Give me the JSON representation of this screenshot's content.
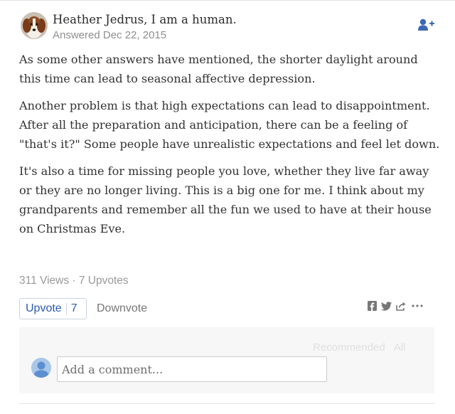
{
  "answer": {
    "author_line": "Heather Jedrus, I am a human.",
    "answered": "Answered Dec 22, 2015",
    "avatar_icon": "dog-avatar-icon",
    "follow_icon": "follow-user-plus-icon",
    "paragraphs": [
      "As some other answers have mentioned, the shorter daylight around this time can lead to seasonal affective depression.",
      "Another problem is that high expectations can lead to disappointment. After all the preparation and anticipation, there can be a feeling of \"that's it?\"  Some people have unrealistic expectations and feel let down.",
      "It's also a time for missing people you love, whether they live far away or they are no longer living.  This is a big one for me. I think about my grandparents and remember all the fun we used to have at their house on Christmas Eve."
    ],
    "stats": "311 Views · 7 Upvotes"
  },
  "actions": {
    "upvote_label": "Upvote",
    "upvote_count": "7",
    "downvote_label": "Downvote",
    "share_icons": [
      "facebook-icon",
      "twitter-icon",
      "share-icon",
      "more-icon"
    ],
    "accent_color": "#2a5db0"
  },
  "comments": {
    "recommended_label": "Recommended",
    "all_label": "All",
    "placeholder": "Add a comment...",
    "avatar_icon": "user-avatar-icon"
  }
}
